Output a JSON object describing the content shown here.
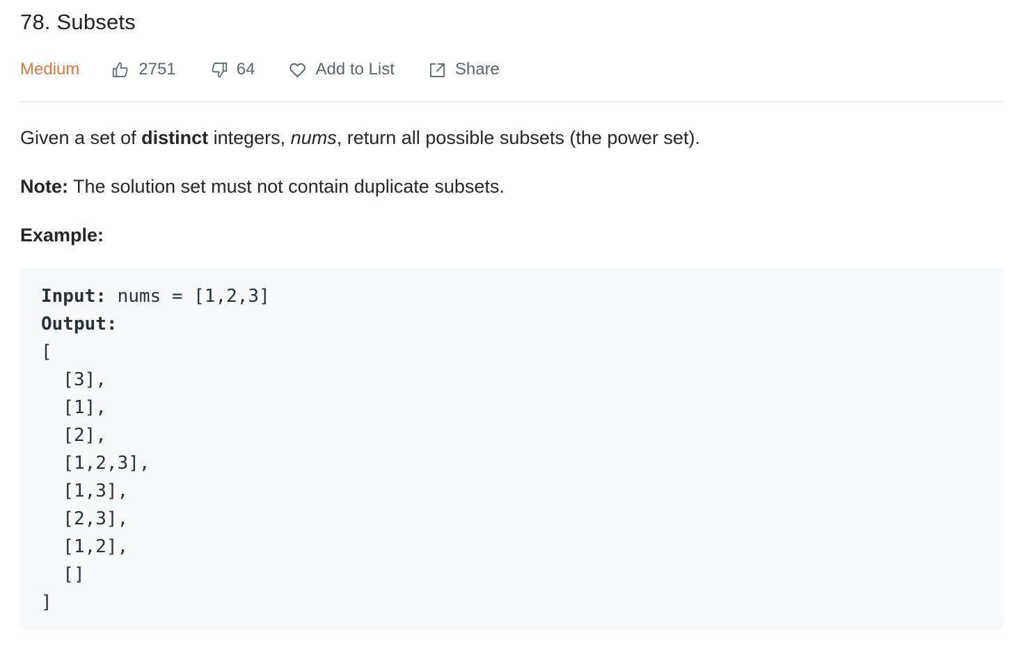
{
  "problem": {
    "title": "78. Subsets",
    "difficulty": "Medium",
    "likes": "2751",
    "dislikes": "64",
    "add_to_list_label": "Add to List",
    "share_label": "Share"
  },
  "description": {
    "p1_before": "Given a set of ",
    "p1_bold": "distinct",
    "p1_middle": " integers, ",
    "p1_italic": "nums",
    "p1_after": ", return all possible subsets (the power set).",
    "note_label": "Note:",
    "note_text": " The solution set must not contain duplicate subsets.",
    "example_label": "Example:"
  },
  "example": {
    "input_label": "Input:",
    "input_value": " nums = [1,2,3]",
    "output_label": "Output:",
    "output_lines": [
      "[",
      "  [3],",
      "  [1],",
      "  [2],",
      "  [1,2,3],",
      "  [1,3],",
      "  [2,3],",
      "  [1,2],",
      "  []",
      "]"
    ]
  },
  "colors": {
    "difficulty_medium": "#e0773a",
    "meta_text": "#5b6770",
    "code_background": "#f7f9fa"
  },
  "icons": [
    "thumbs-up-icon",
    "thumbs-down-icon",
    "heart-icon",
    "share-icon"
  ]
}
